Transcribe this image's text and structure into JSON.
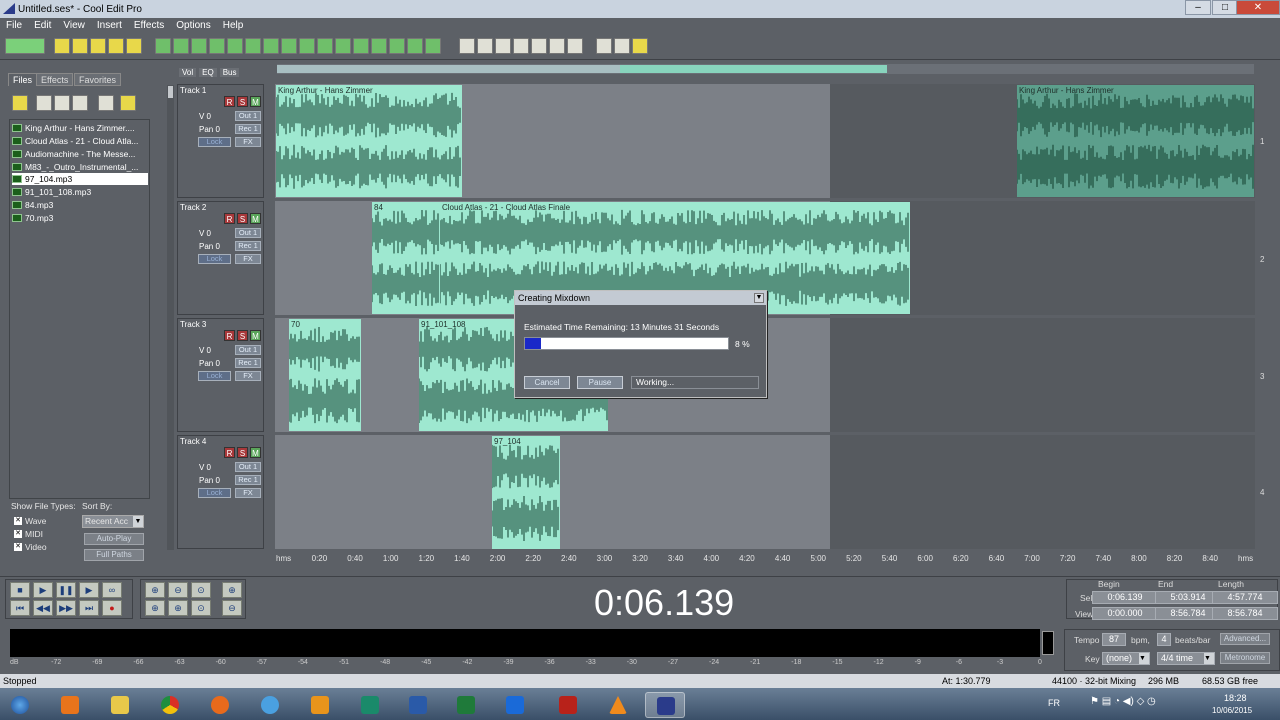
{
  "window": {
    "title": "Untitled.ses* - Cool Edit Pro"
  },
  "menu": [
    "File",
    "Edit",
    "View",
    "Insert",
    "Effects",
    "Options",
    "Help"
  ],
  "left_panel": {
    "tabs": [
      "Files",
      "Effects",
      "Favorites"
    ],
    "files": [
      "King Arthur - Hans Zimmer....",
      "Cloud Atlas - 21 - Cloud Atla...",
      "Audiomachine - The Messe...",
      "M83_-_Outro_Instrumental_...",
      "97_104.mp3",
      "91_101_108.mp3",
      "84.mp3",
      "70.mp3"
    ],
    "selected_file": "97_104.mp3",
    "show_file_types_label": "Show File Types:",
    "sort_by_label": "Sort By:",
    "types": [
      "Wave",
      "MIDI",
      "Video"
    ],
    "sort_value": "Recent Acc",
    "auto_play": "Auto-Play",
    "full_paths": "Full Paths"
  },
  "mixer_tabs": [
    "Vol",
    "EQ",
    "Bus"
  ],
  "tracks": [
    {
      "name": "Track 1",
      "vol": "V 0",
      "pan": "Pan 0",
      "out": "Out 1",
      "rec": "Rec 1",
      "lock": "Lock",
      "fx": "FX",
      "lane": "1"
    },
    {
      "name": "Track 2",
      "vol": "V 0",
      "pan": "Pan 0",
      "out": "Out 1",
      "rec": "Rec 1",
      "lock": "Lock",
      "fx": "FX",
      "lane": "2"
    },
    {
      "name": "Track 3",
      "vol": "V 0",
      "pan": "Pan 0",
      "out": "Out 1",
      "rec": "Rec 1",
      "lock": "Lock",
      "fx": "FX",
      "lane": "3"
    },
    {
      "name": "Track 4",
      "vol": "V 0",
      "pan": "Pan 0",
      "out": "Out 1",
      "rec": "Rec 1",
      "lock": "Lock",
      "fx": "FX",
      "lane": "4"
    }
  ],
  "rsm": {
    "r": "R",
    "s": "S",
    "m": "M"
  },
  "clips": {
    "t1a": "King Arthur - Hans Zimmer",
    "t1b": "King Arthur - Hans Zimmer",
    "t2a": "84",
    "t2b": "Cloud Atlas - 21 - Cloud Atlas Finale",
    "t3a": "70",
    "t3b": "91_101_108",
    "t4a": "97_104"
  },
  "ruler": [
    "hms",
    "0:20",
    "0:40",
    "1:00",
    "1:20",
    "1:40",
    "2:00",
    "2:20",
    "2:40",
    "3:00",
    "3:20",
    "3:40",
    "4:00",
    "4:20",
    "4:40",
    "5:00",
    "5:20",
    "5:40",
    "6:00",
    "6:20",
    "6:40",
    "7:00",
    "7:20",
    "7:40",
    "8:00",
    "8:20",
    "8:40",
    "hms"
  ],
  "dialog": {
    "title": "Creating Mixdown",
    "estimate": "Estimated Time Remaining: 13 Minutes 31 Seconds",
    "progress_percent": 8,
    "progress_label": "8 %",
    "cancel": "Cancel",
    "pause": "Pause",
    "status": "Working..."
  },
  "transport": {
    "timecode": "0:06.139",
    "begin_label": "Begin",
    "end_label": "End",
    "length_label": "Length",
    "sel_label": "Sel",
    "view_label": "View",
    "sel_begin": "0:06.139",
    "sel_end": "5:03.914",
    "sel_length": "4:57.774",
    "view_begin": "0:00.000",
    "view_end": "8:56.784",
    "view_length": "8:56.784",
    "tempo_label": "Tempo",
    "tempo": "87",
    "bpm": "bpm,",
    "beats": "4",
    "beats_label": "beats/bar",
    "advanced": "Advanced...",
    "key_label": "Key",
    "key": "(none)",
    "time_sig": "4/4 time",
    "metronome": "Metronome"
  },
  "meter_ticks": [
    "dB",
    "-72",
    "-69",
    "-66",
    "-63",
    "-60",
    "-57",
    "-54",
    "-51",
    "-48",
    "-45",
    "-42",
    "-39",
    "-36",
    "-33",
    "-30",
    "-27",
    "-24",
    "-21",
    "-18",
    "-15",
    "-12",
    "-9",
    "-6",
    "-3",
    "0"
  ],
  "status": {
    "state": "Stopped",
    "at": "At: 1:30.779",
    "format": "44100 · 32-bit Mixing",
    "mem": "296 MB",
    "free": "68.53 GB free"
  },
  "taskbar": {
    "lang": "FR",
    "time": "18:28",
    "date": "10/06/2015"
  },
  "colors": {
    "clip": "#9ee8d0",
    "wave": "#0f3d2c",
    "progress": "#1a28c8"
  }
}
